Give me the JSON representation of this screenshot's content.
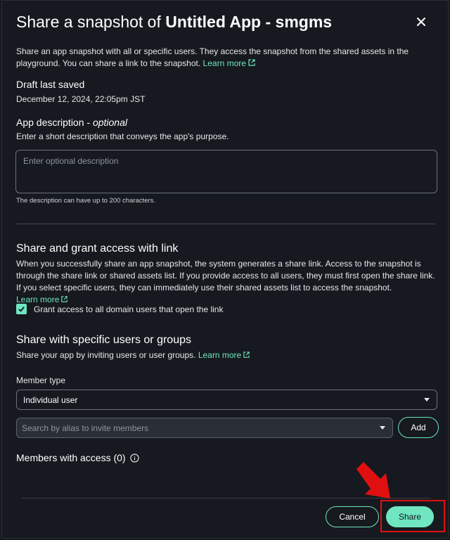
{
  "dialog": {
    "title_prefix": "Share a snapshot of",
    "title_app": "Untitled App - smgms",
    "intro_text": "Share an app snapshot with all or specific users. They access the snapshot from the shared assets in the playground. You can share a link to the snapshot.",
    "intro_link": "Learn more"
  },
  "draft": {
    "heading": "Draft last saved",
    "timestamp": "December 12, 2024, 22:05pm JST"
  },
  "description": {
    "label": "App description - ",
    "label_optional": "optional",
    "hint": "Enter a short description that conveys the app's purpose.",
    "placeholder": "Enter optional description",
    "limit_note": "The description can have up to 200 characters."
  },
  "link_section": {
    "heading": "Share and grant access with link",
    "body": "When you successfully share an app snapshot, the system generates a share link. Access to the snapshot is through the share link or shared assets list. If you provide access to all users, they must first open the share link. If you select specific users, they can immediately use their shared assets list to access the snapshot.",
    "link": "Learn more",
    "checkbox_label": "Grant access to all domain users that open the link",
    "checkbox_checked": true
  },
  "specific_section": {
    "heading": "Share with specific users or groups",
    "body": "Share your app by inviting users or user groups.",
    "link": "Learn more",
    "member_type_label": "Member type",
    "member_type_value": "Individual user",
    "search_placeholder": "Search by alias to invite members",
    "add_label": "Add",
    "members_label": "Members with access (0)"
  },
  "footer": {
    "cancel_label": "Cancel",
    "share_label": "Share"
  },
  "colors": {
    "accent": "#6fe6c0",
    "background": "#16191f",
    "highlight": "#e01010"
  }
}
